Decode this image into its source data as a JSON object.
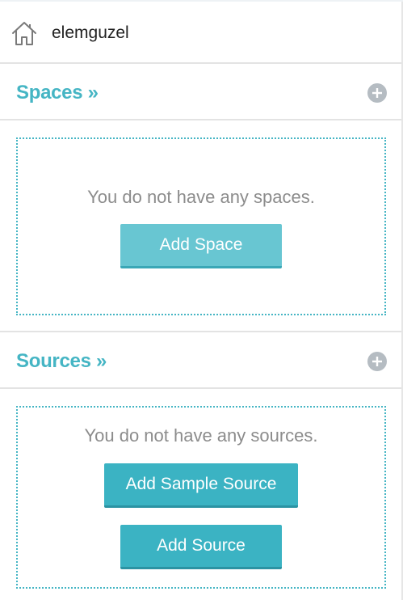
{
  "user": {
    "name": "elemguzel",
    "icon": "home-icon"
  },
  "spaces": {
    "title": "Spaces »",
    "add_icon": "plus-circle-icon",
    "empty_message": "You do not have any spaces.",
    "add_button_label": "Add Space"
  },
  "sources": {
    "title": "Sources »",
    "add_icon": "plus-circle-icon",
    "empty_message": "You do not have any sources.",
    "add_sample_button_label": "Add Sample Source",
    "add_button_label": "Add Source"
  },
  "colors": {
    "accent": "#45b5c4",
    "button_light": "#68c6d2",
    "button_dark": "#3bb3c3",
    "muted_text": "#8c8c8c",
    "plus_icon": "#b5bcc2"
  }
}
